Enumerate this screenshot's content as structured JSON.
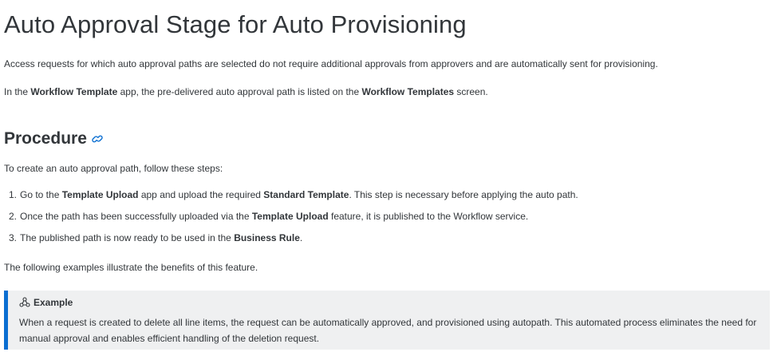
{
  "title": "Auto Approval Stage for Auto Provisioning",
  "intro": "Access requests for which auto approval paths are selected do not require additional approvals from approvers and are automatically sent for provisioning.",
  "workflow_para": {
    "t1": "In the ",
    "b1": "Workflow Template",
    "t2": " app, the pre-delivered auto approval path is listed on the ",
    "b2": "Workflow Templates",
    "t3": " screen."
  },
  "procedure": {
    "heading": "Procedure",
    "link_icon": "link-icon",
    "intro": "To create an auto approval path, follow these steps:",
    "steps": [
      {
        "number": "1.",
        "t1": "Go to the ",
        "b1": "Template Upload",
        "t2": " app and upload the required ",
        "b2": "Standard Template",
        "t3": ". This step is necessary before applying the auto path."
      },
      {
        "number": "2.",
        "t1": "Once the path has been successfully uploaded via the ",
        "b1": "Template Upload",
        "t2": " feature, it is published to the Workflow service."
      },
      {
        "number": "3.",
        "t1": "The published path is now ready to be used in the ",
        "b1": "Business Rule",
        "t2": "."
      }
    ],
    "following": "The following examples illustrate the benefits of this feature."
  },
  "example": {
    "icon": "example-icon",
    "label": "Example",
    "body": "When a request is created to delete all line items, the request can be automatically approved, and provisioned using autopath. This automated process eliminates the need for manual approval and enables efficient handling of the deletion request.",
    "accent_color": "#0a6ed1",
    "background_color": "#eff0f1"
  }
}
